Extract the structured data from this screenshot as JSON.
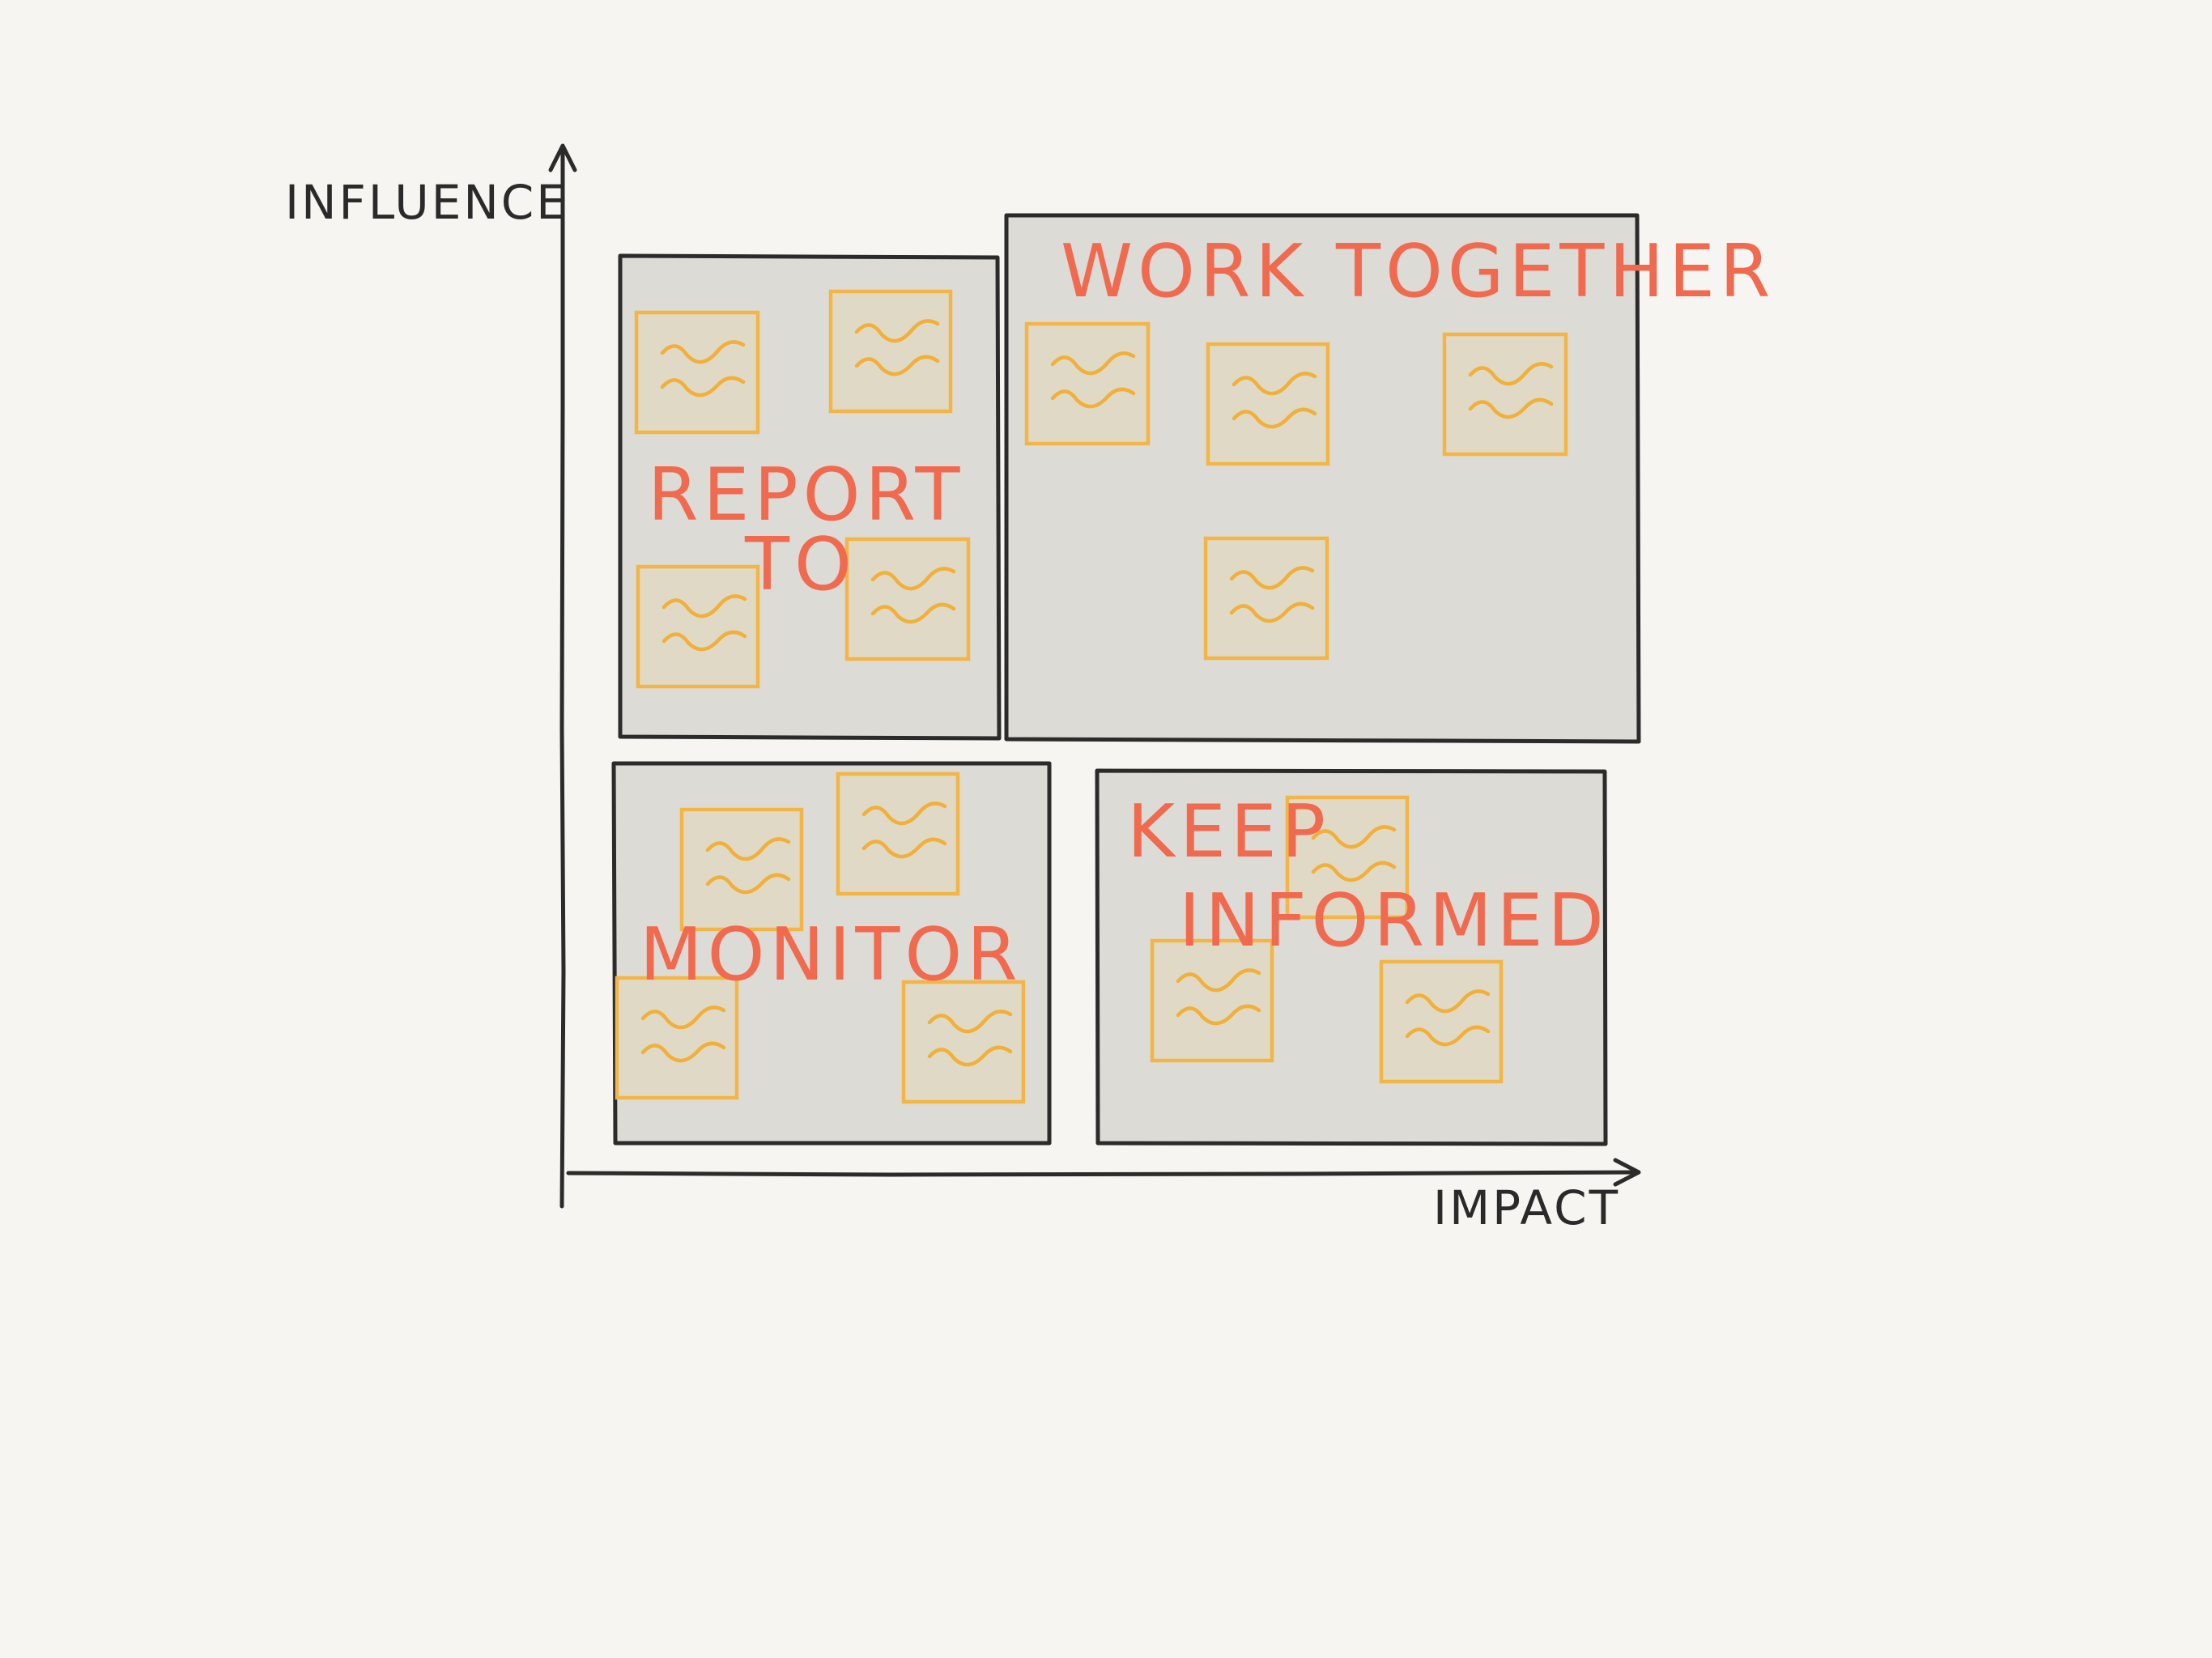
{
  "axes": {
    "y_label": "INFLUENCE",
    "x_label": "IMPACT"
  },
  "quadrants": {
    "report_to": {
      "label_line1": "REPORT",
      "label_line2": "TO"
    },
    "work_together": {
      "label": "WORK TOGETHER"
    },
    "monitor": {
      "label": "MONITOR"
    },
    "keep_informed": {
      "label_line1": "KEEP",
      "label_line2": "INFORMED"
    }
  },
  "colors": {
    "background": "#f6f5f1",
    "quadrant_fill": "#dcdbd5",
    "outline": "#2b2b2b",
    "label": "#f06a4f",
    "sticky_note_border": "#f3b545",
    "sticky_note_fill": "#e0d9c6"
  },
  "icons": {
    "sticky_note": "sticky-note-icon"
  }
}
